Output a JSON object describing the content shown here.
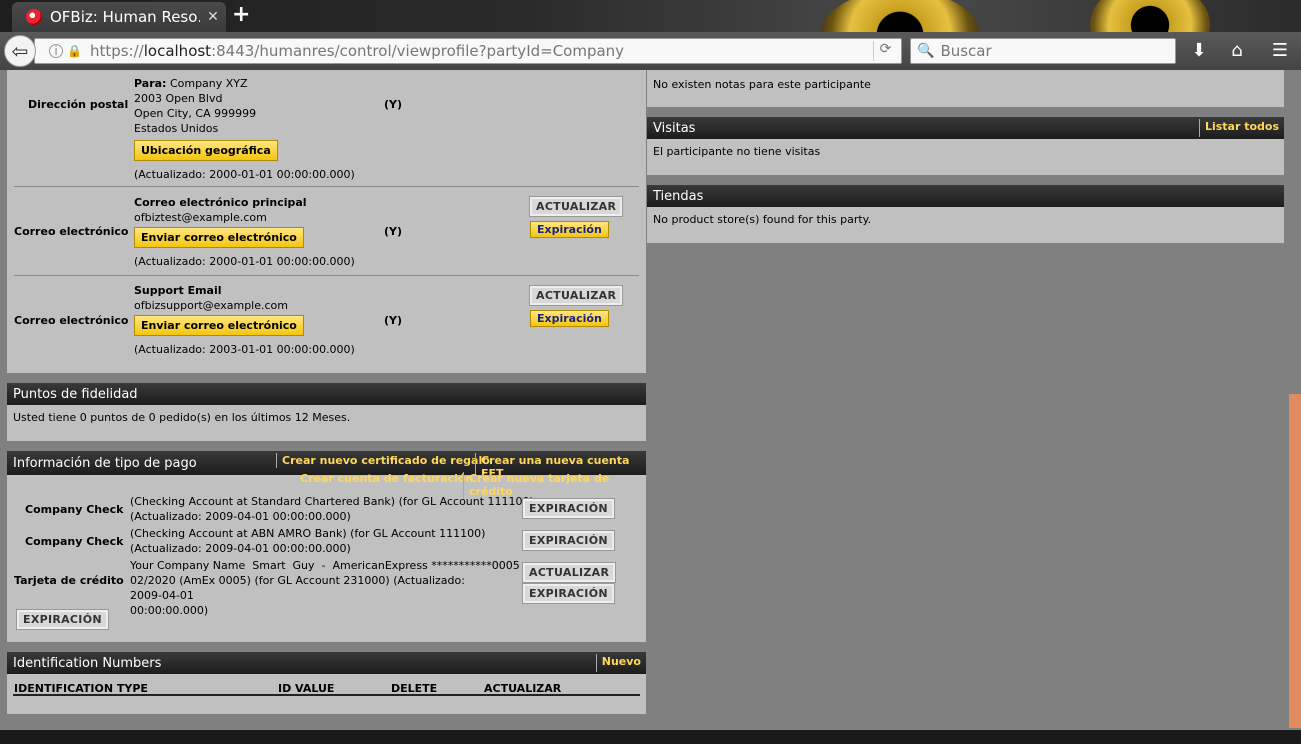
{
  "browser": {
    "tab_title": "OFBiz: Human Reso…",
    "tab_close": "✕",
    "new_tab": "+",
    "url_prefix": "https://",
    "url_host": "localhost",
    "url_rest": ":8443/humanres/control/viewprofile?partyId=Company",
    "search_placeholder": "Buscar"
  },
  "contact": {
    "postal": {
      "label": "Dirección postal",
      "to_label": "Para:",
      "to_name": "Company XYZ",
      "line1": "2003 Open Blvd",
      "line2": "Open City, CA 999999",
      "line3": "Estados Unidos",
      "geo_button": "Ubicación geográfica",
      "updated": "(Actualizado: 2000-01-01 00:00:00.000)",
      "flag": "(Y)"
    },
    "email1": {
      "label": "Correo electrónico",
      "title": "Correo electrónico principal",
      "address": "ofbiztest@example.com",
      "send_button": "Enviar correo electrónico",
      "updated": "(Actualizado: 2000-01-01 00:00:00.000)",
      "flag": "(Y)",
      "update_button": "ACTUALIZAR",
      "expire_button": "Expiración"
    },
    "email2": {
      "label": "Correo electrónico",
      "title": "Support Email",
      "address": "ofbizsupport@example.com",
      "send_button": "Enviar correo electrónico",
      "updated": "(Actualizado: 2003-01-01 00:00:00.000)",
      "flag": "(Y)",
      "update_button": "ACTUALIZAR",
      "expire_button": "Expiración"
    }
  },
  "loyalty": {
    "title": "Puntos de fidelidad",
    "text": "Usted tiene 0 puntos de 0 pedido(s) en los últimos 12 Meses."
  },
  "payment": {
    "title": "Información de tipo de pago",
    "link_gift": "Crear nuevo certificado de regalo",
    "link_eft": "Crear una nueva cuenta EFT",
    "link_billing": "Crear cuenta de facturación",
    "link_card": "Crear nueva tarjeta de crédito",
    "rows": [
      {
        "label": "Company Check",
        "line1": "(Checking Account at Standard Chartered Bank) (for GL Account 111100)",
        "line2": "(Actualizado: 2009-04-01 00:00:00.000)",
        "button": "EXPIRACIÓN"
      },
      {
        "label": "Company Check",
        "line1": "(Checking Account at ABN AMRO Bank) (for GL Account 111100)",
        "line2": "(Actualizado: 2009-04-01 00:00:00.000)",
        "button": "EXPIRACIÓN"
      }
    ],
    "card": {
      "label": "Tarjeta de crédito",
      "line1": "Your Company Name  Smart  Guy  -  AmericanExpress ***********0005",
      "line2": "02/2020 (AmEx 0005) (for GL Account 231000) (Actualizado: 2009-04-01",
      "line3": "00:00:00.000)",
      "update_button": "ACTUALIZAR",
      "expire_button": "EXPIRACIÓN"
    },
    "bottom_button": "EXPIRACIÓN"
  },
  "identification": {
    "title": "Identification Numbers",
    "new_link": "Nuevo",
    "columns": [
      "IDENTIFICATION TYPE",
      "ID VALUE",
      "DELETE",
      "ACTUALIZAR"
    ]
  },
  "notes": {
    "text": "No existen notas para este participante"
  },
  "visits": {
    "title": "Visitas",
    "link": "Listar todos",
    "text": "El participante no tiene visitas"
  },
  "stores": {
    "title": "Tiendas",
    "text": "No product store(s) found for this party."
  }
}
